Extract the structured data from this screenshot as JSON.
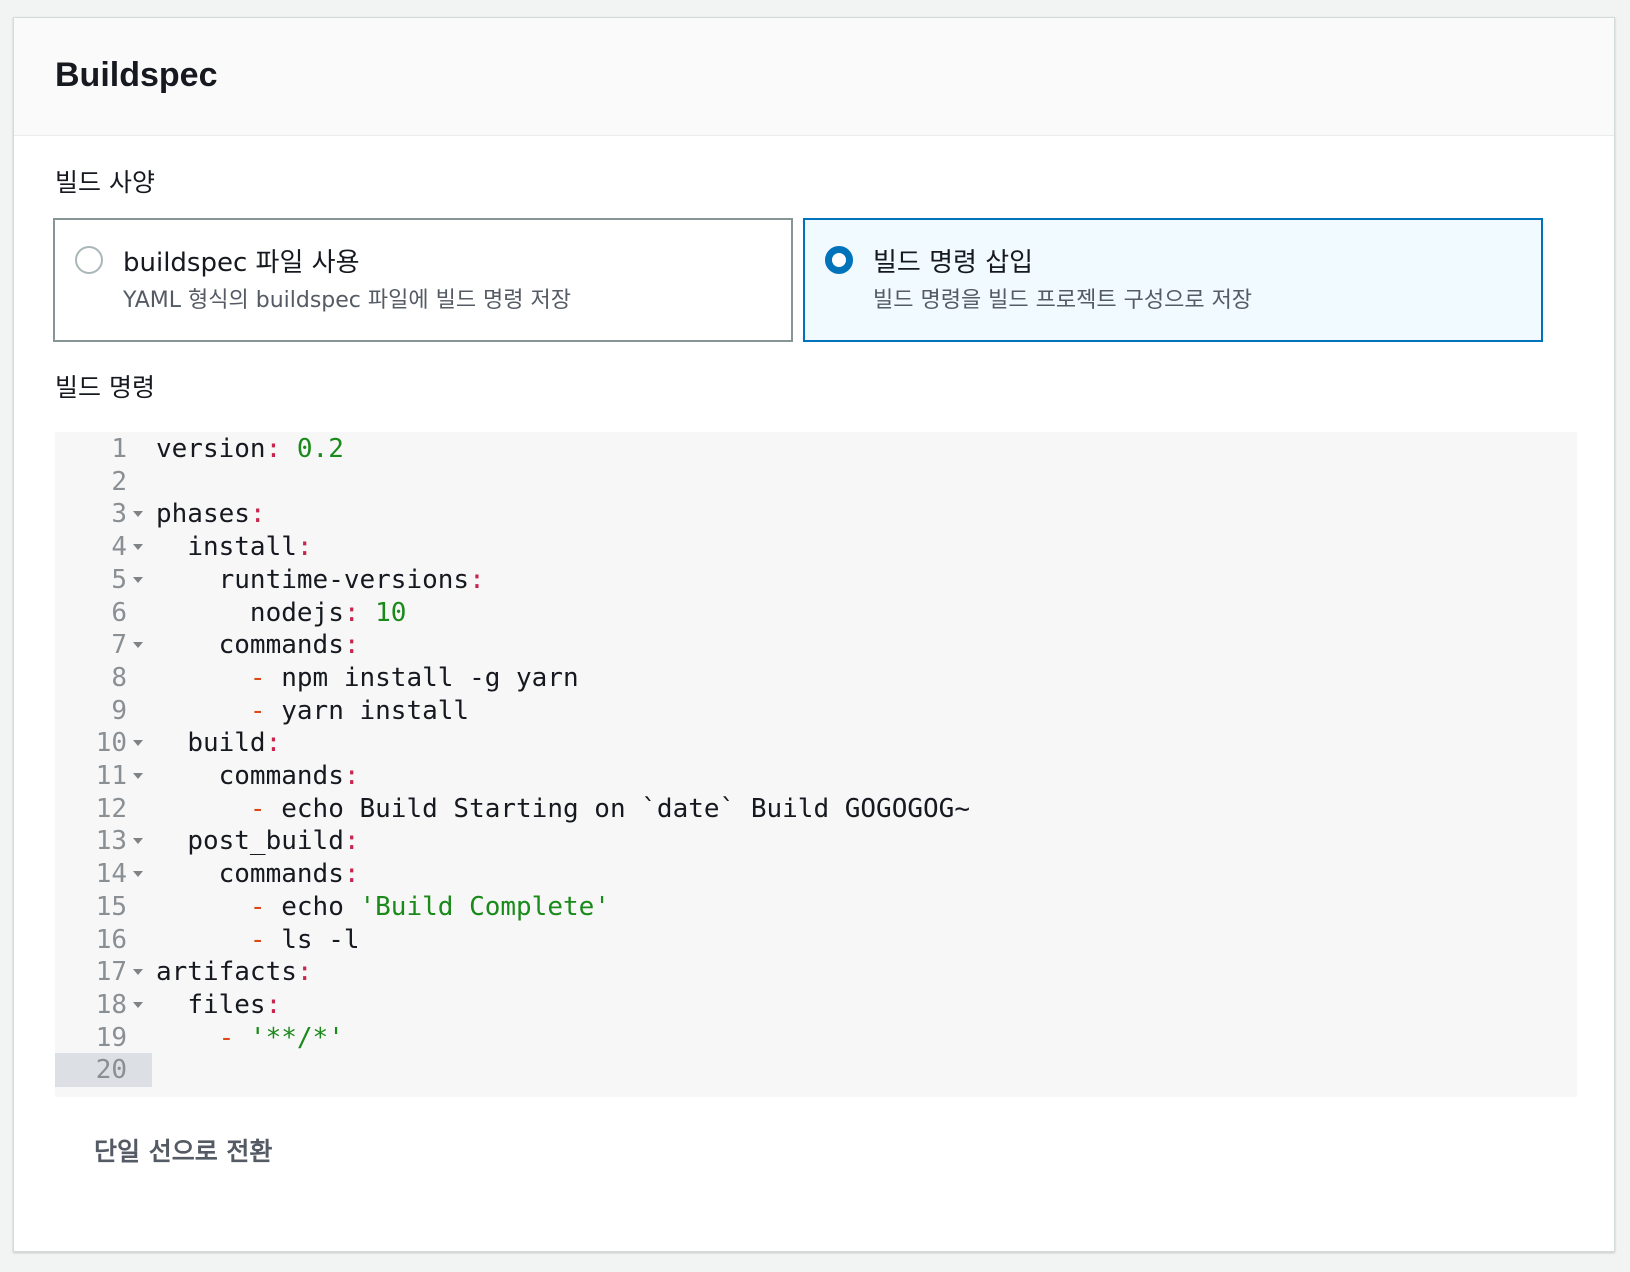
{
  "panel": {
    "title": "Buildspec"
  },
  "build_spec": {
    "label": "빌드 사양",
    "options": [
      {
        "title": "buildspec 파일 사용",
        "description": "YAML 형식의 buildspec 파일에 빌드 명령 저장",
        "selected": false
      },
      {
        "title": "빌드 명령 삽입",
        "description": "빌드 명령을 빌드 프로젝트 구성으로 저장",
        "selected": true
      }
    ]
  },
  "build_commands": {
    "label": "빌드 명령",
    "active_line": 20,
    "lines": [
      {
        "n": "1",
        "fold": false,
        "indent": "",
        "key": "version",
        "colon": ":",
        "dash": "",
        "value": " 0.2",
        "value_type": "num"
      },
      {
        "n": "2",
        "fold": false,
        "indent": "",
        "key": "",
        "colon": "",
        "dash": "",
        "value": "",
        "value_type": "plain"
      },
      {
        "n": "3",
        "fold": true,
        "indent": "",
        "key": "phases",
        "colon": ":",
        "dash": "",
        "value": "",
        "value_type": "plain"
      },
      {
        "n": "4",
        "fold": true,
        "indent": "  ",
        "key": "install",
        "colon": ":",
        "dash": "",
        "value": "",
        "value_type": "plain"
      },
      {
        "n": "5",
        "fold": true,
        "indent": "    ",
        "key": "runtime-versions",
        "colon": ":",
        "dash": "",
        "value": "",
        "value_type": "plain"
      },
      {
        "n": "6",
        "fold": false,
        "indent": "      ",
        "key": "nodejs",
        "colon": ":",
        "dash": "",
        "value": " 10",
        "value_type": "num"
      },
      {
        "n": "7",
        "fold": true,
        "indent": "    ",
        "key": "commands",
        "colon": ":",
        "dash": "",
        "value": "",
        "value_type": "plain"
      },
      {
        "n": "8",
        "fold": false,
        "indent": "      ",
        "key": "",
        "colon": "",
        "dash": "-",
        "value": " npm install -g yarn",
        "value_type": "plain"
      },
      {
        "n": "9",
        "fold": false,
        "indent": "      ",
        "key": "",
        "colon": "",
        "dash": "-",
        "value": " yarn install",
        "value_type": "plain"
      },
      {
        "n": "10",
        "fold": true,
        "indent": "  ",
        "key": "build",
        "colon": ":",
        "dash": "",
        "value": "",
        "value_type": "plain"
      },
      {
        "n": "11",
        "fold": true,
        "indent": "    ",
        "key": "commands",
        "colon": ":",
        "dash": "",
        "value": "",
        "value_type": "plain"
      },
      {
        "n": "12",
        "fold": false,
        "indent": "      ",
        "key": "",
        "colon": "",
        "dash": "-",
        "value": " echo Build Starting on `date` Build GOGOGOG~",
        "value_type": "plain"
      },
      {
        "n": "13",
        "fold": true,
        "indent": "  ",
        "key": "post_build",
        "colon": ":",
        "dash": "",
        "value": "",
        "value_type": "plain"
      },
      {
        "n": "14",
        "fold": true,
        "indent": "    ",
        "key": "commands",
        "colon": ":",
        "dash": "",
        "value": "",
        "value_type": "plain"
      },
      {
        "n": "15",
        "fold": false,
        "indent": "      ",
        "key": "",
        "colon": "",
        "dash": "-",
        "value": " echo ",
        "value_type": "plain",
        "tail": "'Build Complete'",
        "tail_type": "str"
      },
      {
        "n": "16",
        "fold": false,
        "indent": "      ",
        "key": "",
        "colon": "",
        "dash": "-",
        "value": " ls -l",
        "value_type": "plain"
      },
      {
        "n": "17",
        "fold": true,
        "indent": "",
        "key": "artifacts",
        "colon": ":",
        "dash": "",
        "value": "",
        "value_type": "plain"
      },
      {
        "n": "18",
        "fold": true,
        "indent": "  ",
        "key": "files",
        "colon": ":",
        "dash": "",
        "value": "",
        "value_type": "plain"
      },
      {
        "n": "19",
        "fold": false,
        "indent": "    ",
        "key": "",
        "colon": "",
        "dash": "-",
        "value": " '**/*'",
        "value_type": "str"
      },
      {
        "n": "20",
        "fold": false,
        "indent": "",
        "key": "",
        "colon": "",
        "dash": "",
        "value": "",
        "value_type": "plain"
      }
    ]
  },
  "toggle": {
    "label": "단일 선으로 전환"
  },
  "colors": {
    "accent": "#0073bb",
    "selected_bg": "#f1faff",
    "punct": "#c7254e",
    "dash": "#dd4814",
    "literal": "#1a8a1a"
  }
}
